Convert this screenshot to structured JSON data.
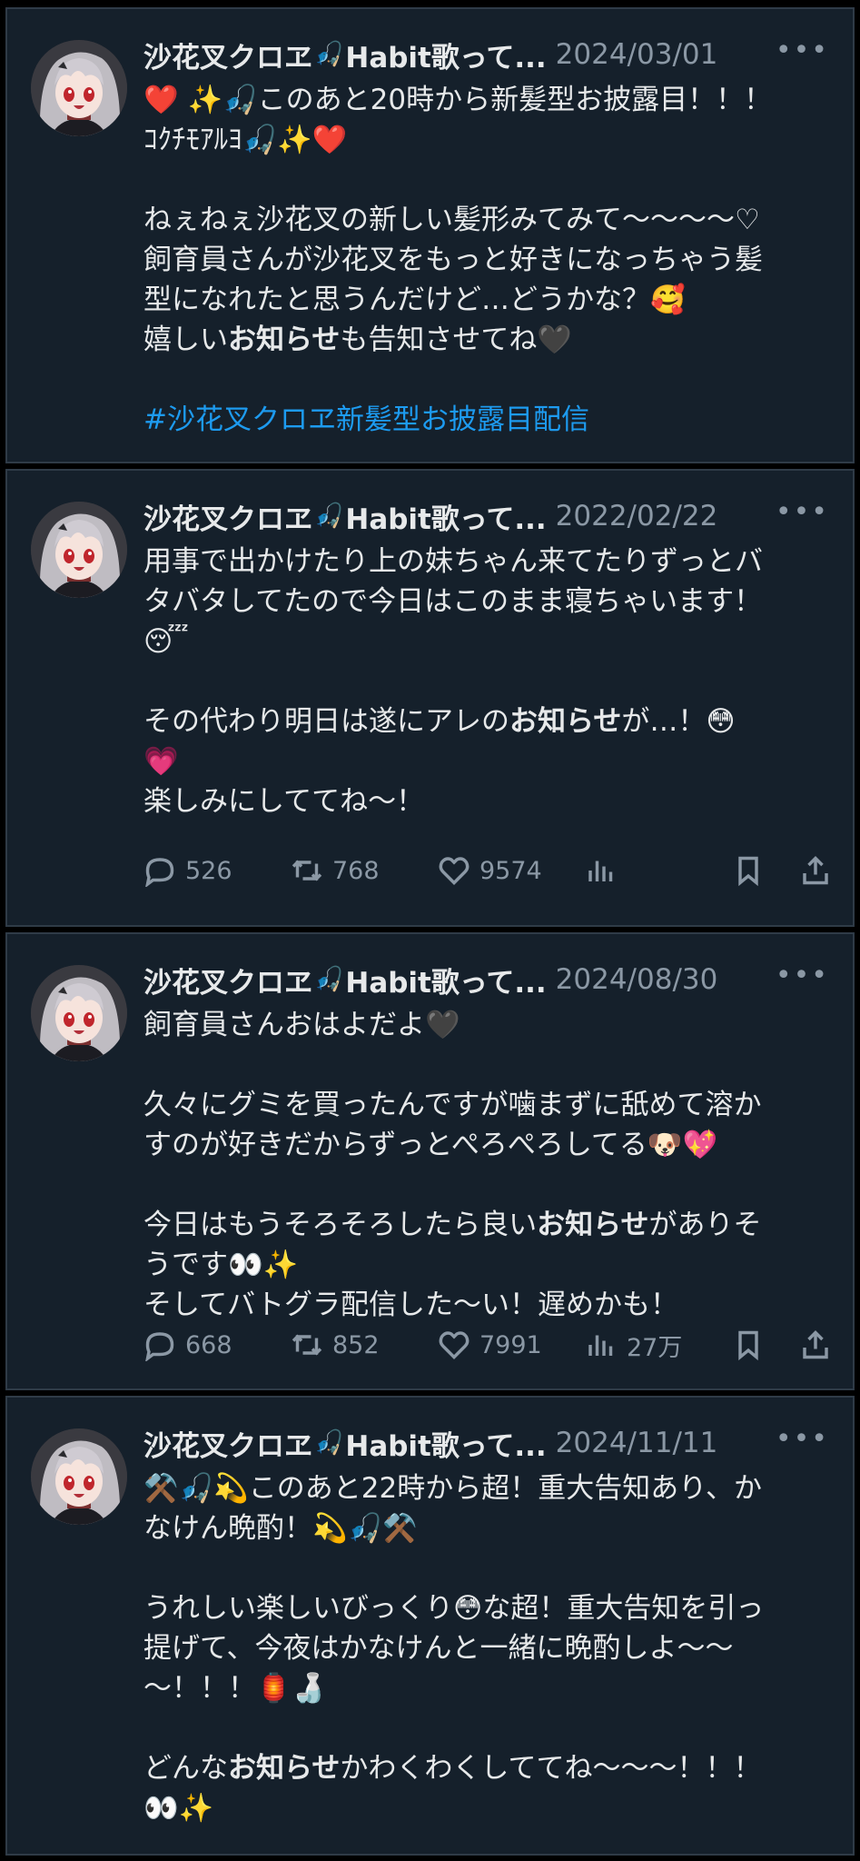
{
  "colors": {
    "background": "#000000",
    "card": "#15202b",
    "text": "#e7e9ea",
    "muted": "#8b98a5",
    "link": "#1d9bf0"
  },
  "tweets": [
    {
      "name": "沙花叉クロヱ",
      "name_suffix": "Habit歌って...",
      "date": "2024/03/01",
      "more": "•••",
      "lines": [
        "❤️ ✨🎣このあと20時から新髪型お披露目！！！",
        "ｺｸﾁﾓｱﾙﾖ🎣✨❤️",
        "",
        "ねぇねぇ沙花叉の新しい髪形みてみて〜〜〜〜♡",
        "飼育員さんが沙花叉をもっと好きになっちゃう髪",
        "型になれたと思うんだけど…どうかな？🥰",
        "嬉しい|お知らせ|も告知させてね🖤",
        ""
      ],
      "hashtag": "#沙花叉クロヱ新髪型お披露目配信",
      "stats": null
    },
    {
      "name": "沙花叉クロヱ",
      "name_suffix": "Habit歌って...",
      "date": "2022/02/22",
      "more": "•••",
      "lines": [
        "用事で出かけたり上の妹ちゃん来てたりずっとバ",
        "タバタしてたので今日はこのまま寝ちゃいます！",
        "😴",
        "",
        "その代わり明日は遂にアレの|お知らせ|が…！😳",
        "💗",
        "楽しみにしててね〜！"
      ],
      "hashtag": "",
      "stats": {
        "replies": "526",
        "retweets": "768",
        "likes": "9574",
        "views": ""
      }
    },
    {
      "name": "沙花叉クロヱ",
      "name_suffix": "Habit歌って...",
      "date": "2024/08/30",
      "more": "•••",
      "lines": [
        "飼育員さんおはよだよ🖤",
        "",
        "久々にグミを買ったんですが噛まずに舐めて溶か",
        "すのが好きだからずっとぺろぺろしてる🐶💖",
        "",
        "今日はもうそろそろしたら良い|お知らせ|がありそ",
        "うです👀✨",
        "そしてバトグラ配信した〜い！遅めかも！"
      ],
      "hashtag": "",
      "stats": {
        "replies": "668",
        "retweets": "852",
        "likes": "7991",
        "views": "27万"
      }
    },
    {
      "name": "沙花叉クロヱ",
      "name_suffix": "Habit歌って...",
      "date": "2024/11/11",
      "more": "•••",
      "lines": [
        "⚒️🎣💫このあと22時から超！重大告知あり、か",
        "なけん晩酌！💫🎣⚒️",
        "",
        "うれしい楽しいびっくり😳な超！重大告知を引っ",
        "提げて、今夜はかなけんと一緒に晩酌しよ〜〜",
        "〜！！！🏮🍶",
        "",
        "どんな|お知らせ|かわくわくしててね〜〜〜！！！",
        "👀✨"
      ],
      "hashtag": "",
      "stats": null
    }
  ]
}
